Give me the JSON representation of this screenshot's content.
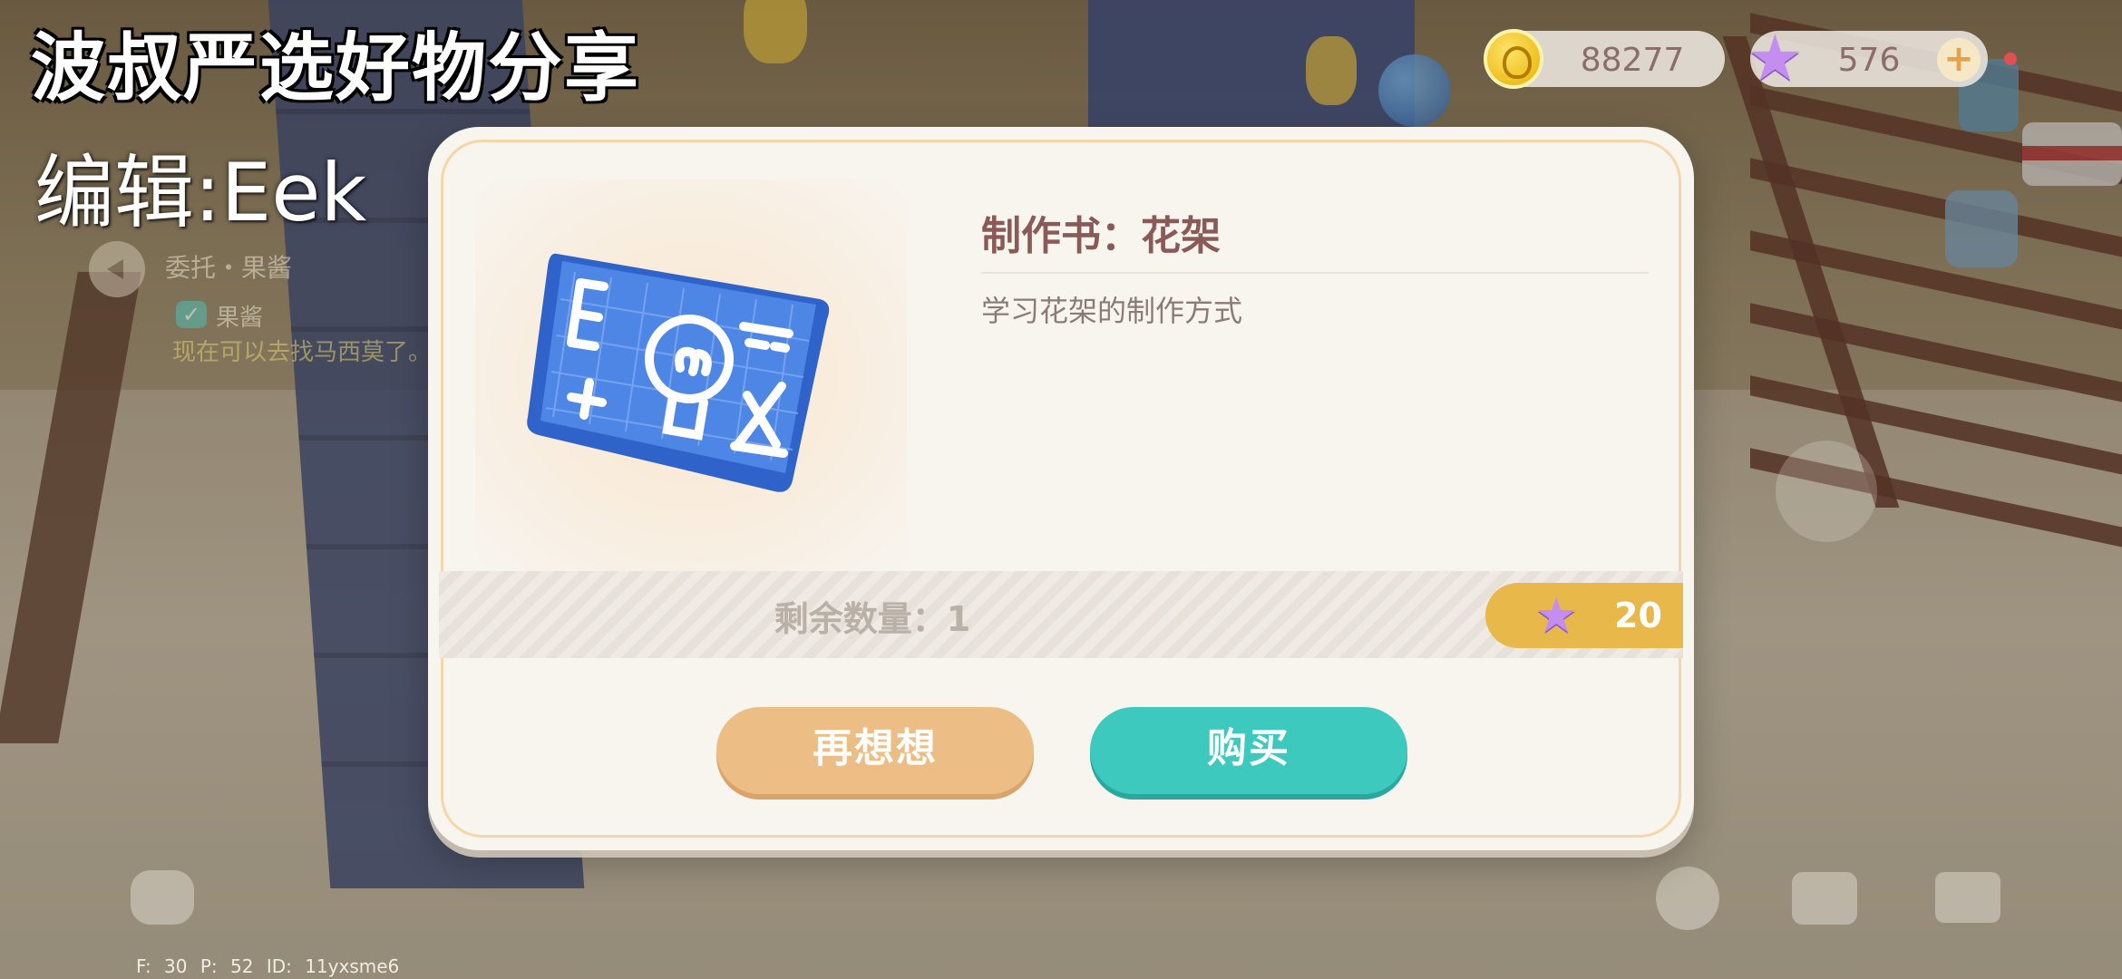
{
  "overlay": {
    "title": "波叔严选好物分享",
    "editor": "编辑:Eek"
  },
  "quest": {
    "title": "委托・果酱",
    "subtask": "果酱",
    "description": "现在可以去找马西莫了。"
  },
  "currency": {
    "gold": "88277",
    "stars": "576",
    "add_label": "+"
  },
  "dialog": {
    "item_title": "制作书：花架",
    "item_description": "学习花架的制作方式",
    "stock_label": "剩余数量：1",
    "price": "20",
    "price_icon": "star-icon",
    "cancel_label": "再想想",
    "buy_label": "购买"
  },
  "debug": {
    "text": "F: 30 P: 52 ID: 11yxsme6"
  },
  "colors": {
    "buy_button": "#3ec9bf",
    "cancel_button": "#ecbd85",
    "price_tag": "#e8b84a",
    "title_text": "#8a5a58"
  }
}
